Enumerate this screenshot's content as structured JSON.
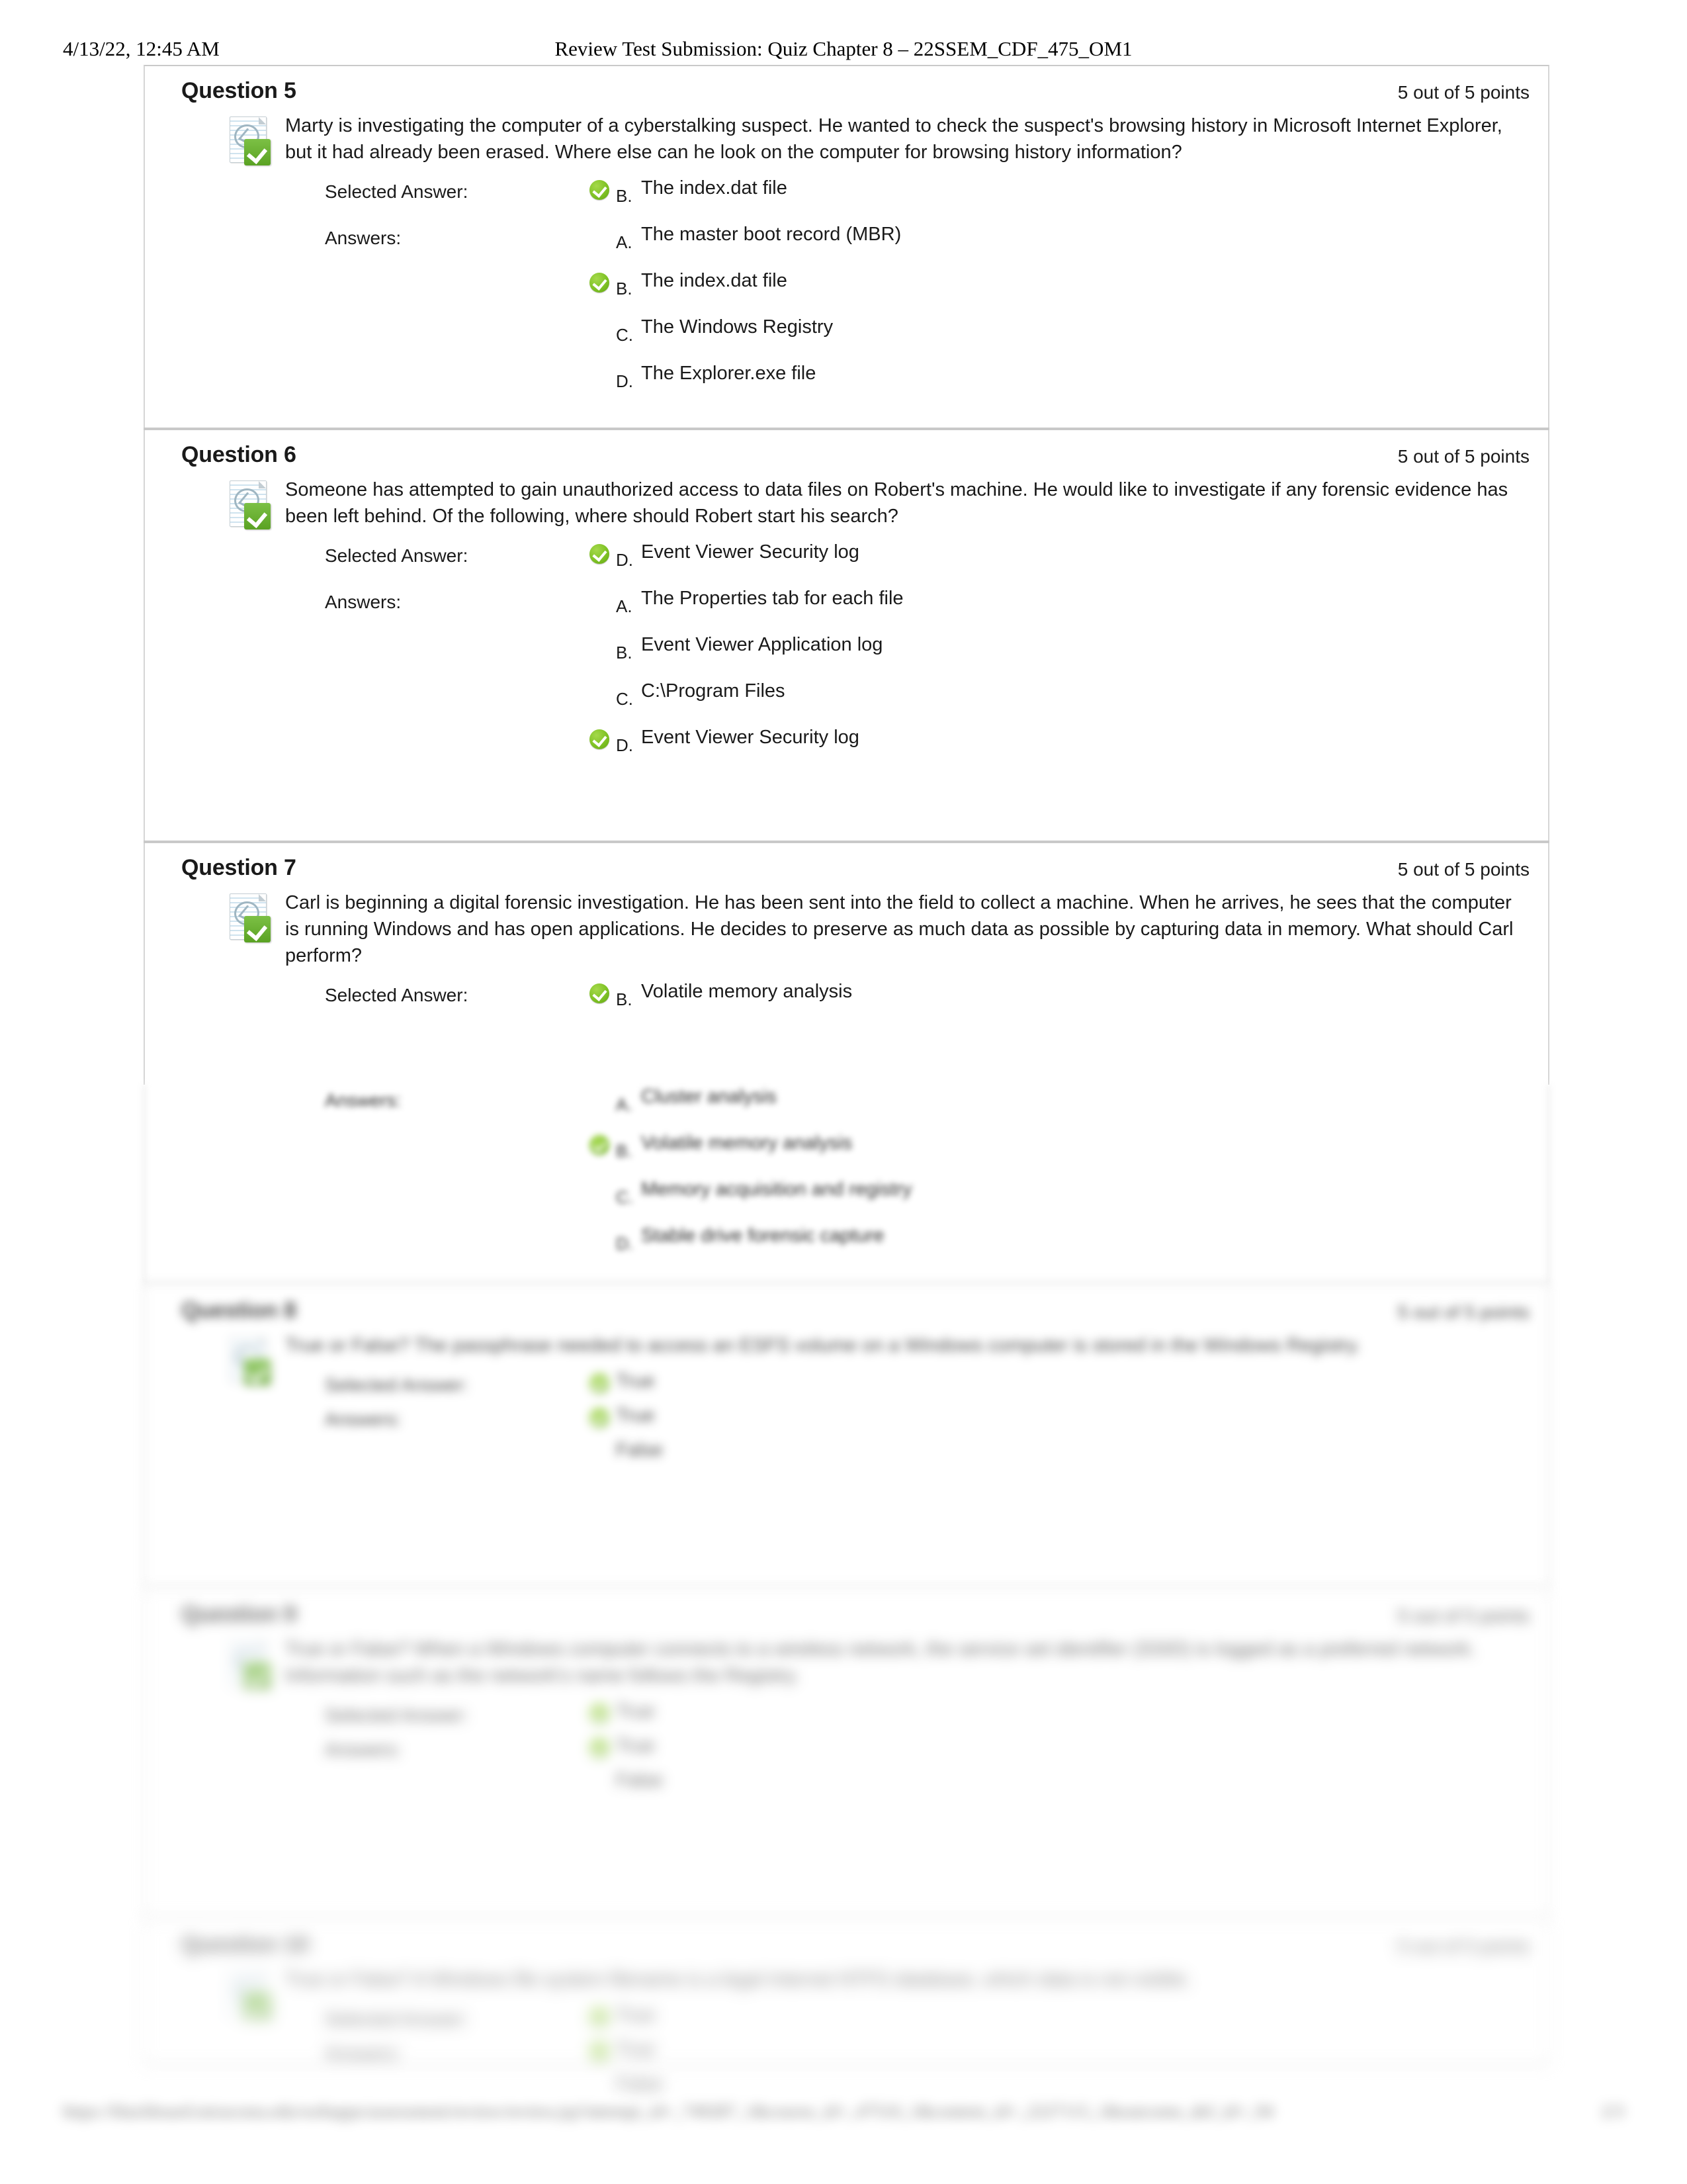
{
  "print_header": {
    "date": "4/13/22, 12:45 AM",
    "title": "Review Test Submission: Quiz Chapter 8 – 22SSEM_CDF_475_OM1"
  },
  "labels": {
    "selected_answer": "Selected Answer:",
    "answers": "Answers:"
  },
  "questions": [
    {
      "title": "Question 5",
      "points": "5 out of 5 points",
      "text": "Marty is investigating the computer of a cyberstalking suspect. He wanted to check the suspect's browsing history in Microsoft Internet Explorer, but it had already been erased. Where else can he look on the computer for browsing history information?",
      "selected": {
        "letter": "B.",
        "text": "The index.dat file",
        "correct": true
      },
      "options": [
        {
          "letter": "A.",
          "text": "The master boot record (MBR)",
          "correct": false
        },
        {
          "letter": "B.",
          "text": "The index.dat file",
          "correct": true
        },
        {
          "letter": "C.",
          "text": "The Windows Registry",
          "correct": false
        },
        {
          "letter": "D.",
          "text": "The Explorer.exe file",
          "correct": false
        }
      ]
    },
    {
      "title": "Question 6",
      "points": "5 out of 5 points",
      "text": "Someone has attempted to gain unauthorized access to data files on Robert's machine. He would like to investigate if any forensic evidence has been left behind. Of the following, where should Robert start his search?",
      "selected": {
        "letter": "D.",
        "text": "Event Viewer Security log",
        "correct": true
      },
      "options": [
        {
          "letter": "A.",
          "text": "The Properties tab for each file",
          "correct": false
        },
        {
          "letter": "B.",
          "text": "Event Viewer Application log",
          "correct": false
        },
        {
          "letter": "C.",
          "text": "C:\\Program Files",
          "correct": false
        },
        {
          "letter": "D.",
          "text": "Event Viewer Security log",
          "correct": true
        }
      ]
    },
    {
      "title": "Question 7",
      "points": "5 out of 5 points",
      "text": "Carl is beginning a digital forensic investigation. He has been sent into the field to collect a machine. When he arrives, he sees that the computer is running Windows and has open applications. He decides to preserve as much data as possible by capturing data in memory. What should Carl perform?",
      "selected": {
        "letter": "B.",
        "text": "Volatile memory analysis",
        "correct": true
      },
      "options": [
        {
          "letter": "A.",
          "text": "Cluster analysis",
          "correct": false
        },
        {
          "letter": "B.",
          "text": "Volatile memory analysis",
          "correct": true
        },
        {
          "letter": "C.",
          "text": "Memory acquisition and registry",
          "correct": false
        },
        {
          "letter": "D.",
          "text": "Stable drive forensic capture",
          "correct": false
        }
      ]
    },
    {
      "title": "Question 8",
      "points": "5 out of 5 points",
      "text": "True or False? The passphrase needed to access an ESFS volume on a Windows computer is stored in the Windows Registry.",
      "selected": {
        "letter": "",
        "text": "True",
        "correct": true
      },
      "options": [
        {
          "letter": "",
          "text": "True",
          "correct": true
        },
        {
          "letter": "",
          "text": "False",
          "correct": false
        }
      ]
    },
    {
      "title": "Question 9",
      "points": "5 out of 5 points",
      "text": "True or False? When a Windows computer connects to a wireless network, the service set identifier (SSID) is logged as a preferred network. Information such as the network's name follows the Registry.",
      "selected": {
        "letter": "",
        "text": "True",
        "correct": true
      },
      "options": [
        {
          "letter": "",
          "text": "True",
          "correct": true
        },
        {
          "letter": "",
          "text": "False",
          "correct": false
        }
      ]
    },
    {
      "title": "Question 10",
      "points": "5 out of 5 points",
      "text": "True or False? A Windows file system filename is a legal Internet NTFS database, which data is not visible.",
      "selected": {
        "letter": "",
        "text": "True",
        "correct": true
      },
      "options": [
        {
          "letter": "",
          "text": "True",
          "correct": true
        },
        {
          "letter": "",
          "text": "False",
          "correct": false
        }
      ]
    }
  ],
  "footer": {
    "url": "https://blackboard.miracosta.edu/webapps/assessment/review/review.jsp?attempt_id=_749287_1&course_id=_47510_1&content_id=_2227115_1&outcome_def_id=_94",
    "page": "2/3"
  }
}
